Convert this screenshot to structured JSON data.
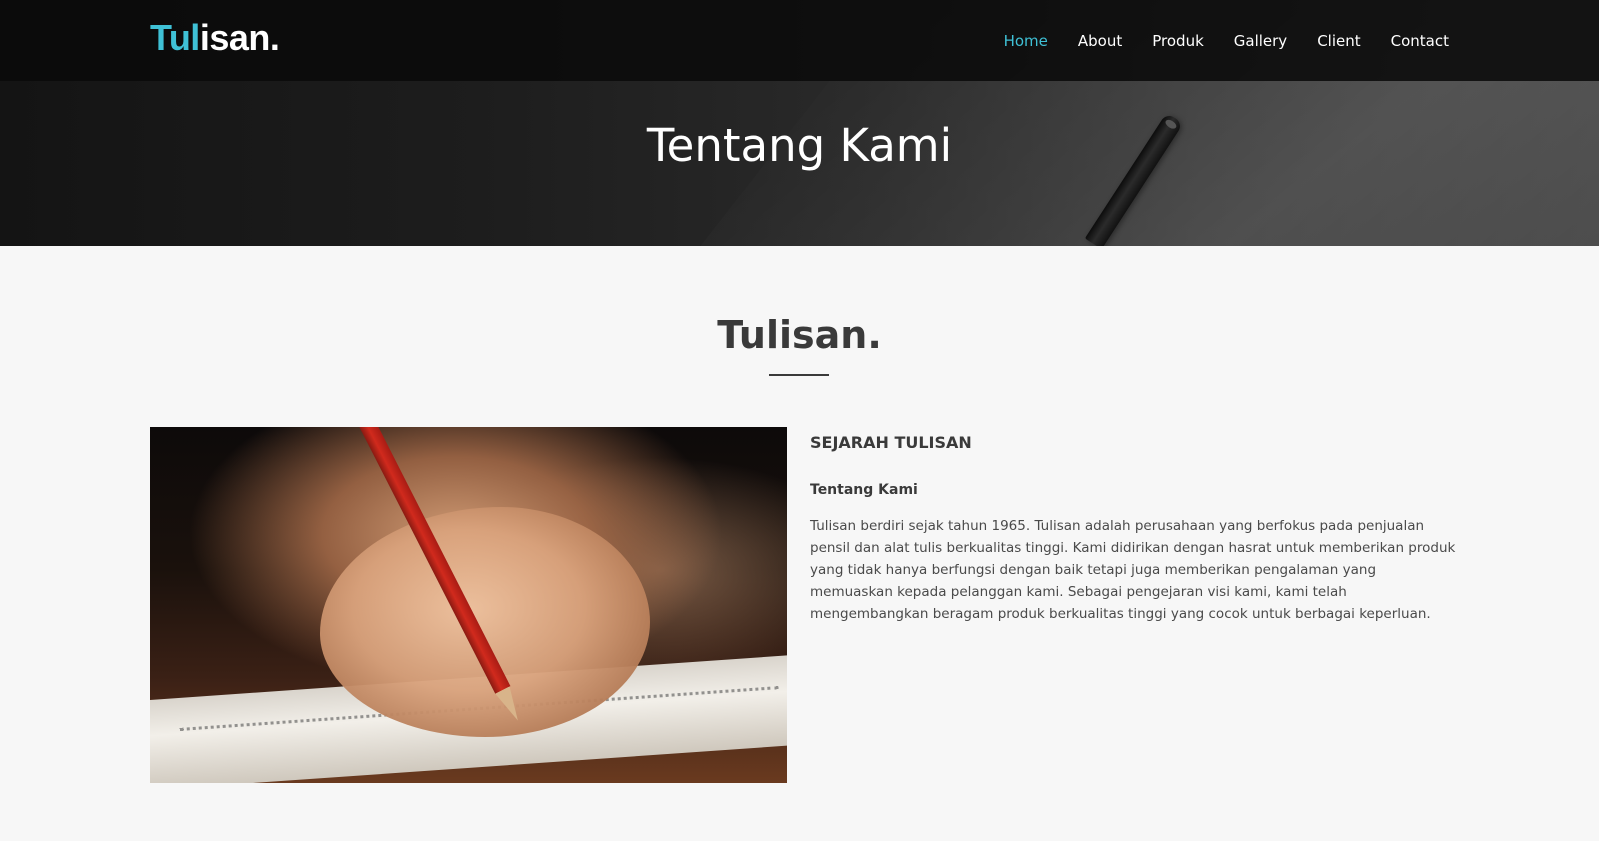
{
  "header": {
    "logo_accent": "Tul",
    "logo_rest": "isan.",
    "nav": [
      {
        "label": "Home"
      },
      {
        "label": "About"
      },
      {
        "label": "Produk"
      },
      {
        "label": "Gallery"
      },
      {
        "label": "Client"
      },
      {
        "label": "Contact"
      }
    ]
  },
  "hero": {
    "title": "Tentang Kami"
  },
  "section": {
    "heading": "Tulisan."
  },
  "about": {
    "history_title": "SEJARAH TULISAN",
    "subtitle": "Tentang Kami",
    "body": "Tulisan berdiri sejak tahun 1965. Tulisan adalah perusahaan yang berfokus pada penjualan pensil dan alat tulis berkualitas tinggi. Kami didirikan dengan hasrat untuk memberikan produk yang tidak hanya berfungsi dengan baik tetapi juga memberikan pengalaman yang memuaskan kepada pelanggan kami. Sebagai pengejaran visi kami, kami telah mengembangkan beragam produk berkualitas tinggi yang cocok untuk berbagai keperluan."
  },
  "colors": {
    "accent": "#3fc1d6",
    "navbar_bg": "#0a0a0a",
    "page_bg": "#f7f7f7",
    "heading_text": "#3a3a3a"
  }
}
